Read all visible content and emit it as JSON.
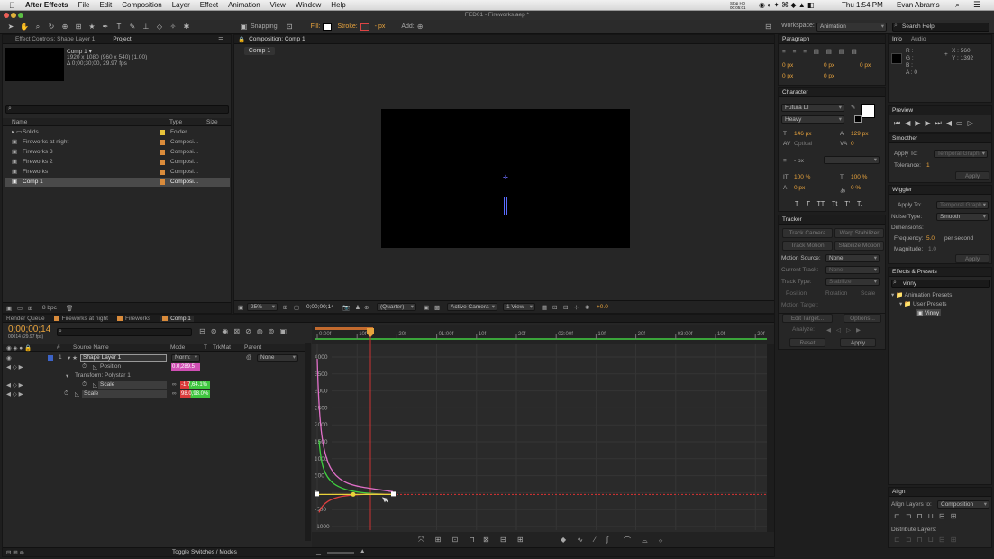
{
  "menubar": {
    "apple": "",
    "items": [
      "After Effects",
      "File",
      "Edit",
      "Composition",
      "Layer",
      "Effect",
      "Animation",
      "View",
      "Window",
      "Help"
    ],
    "status_small": "Stop HD 00:05:01",
    "time": "Thu 1:54 PM",
    "user": "Evan Abrams"
  },
  "window": {
    "title": "FED01 - Fireworks.aep *"
  },
  "toolbar": {
    "snapping": "Snapping",
    "fill": "Fill:",
    "stroke": "Stroke:",
    "px": "- px",
    "add": "Add:",
    "workspace_label": "Workspace:",
    "workspace_value": "Animation",
    "search_placeholder": "Search Help"
  },
  "project": {
    "tab_effect": "Effect Controls: Shape Layer 1",
    "tab_project": "Project",
    "comp_name": "Comp 1 ▾",
    "comp_info1": "1920 x 1080 (960 x 540) (1.00)",
    "comp_info2": "Δ 0;00;30;00, 29.97 fps",
    "search_placeholder": "",
    "col_name": "Name",
    "col_type": "Type",
    "col_size": "Size",
    "items": [
      {
        "name": "Solids",
        "type": "Folder",
        "color": "#e6c23a"
      },
      {
        "name": "Fireworks at night",
        "type": "Composi...",
        "color": "#d98b3b"
      },
      {
        "name": "Fireworks 3",
        "type": "Composi...",
        "color": "#d98b3b"
      },
      {
        "name": "Fireworks 2",
        "type": "Composi...",
        "color": "#d98b3b"
      },
      {
        "name": "Fireworks",
        "type": "Composi...",
        "color": "#d98b3b"
      },
      {
        "name": "Comp 1",
        "type": "Composi...",
        "color": "#d98b3b"
      }
    ],
    "bpc": "8 bpc"
  },
  "composition": {
    "tab": "Composition: Comp 1",
    "subtab": "Comp 1",
    "zoom": "25%",
    "timecode": "0;00;00;14",
    "quality": "(Quarter)",
    "camera": "Active Camera",
    "view": "1 View",
    "exposure": "+0.0"
  },
  "paragraph": {
    "title": "Paragraph",
    "v1": "0 px",
    "v2": "0 px",
    "v3": "0 px",
    "v4": "0 px",
    "v5": "0 px"
  },
  "character": {
    "title": "Character",
    "font": "Futura LT",
    "style": "Heavy",
    "size": "146 px",
    "leading": "129 px",
    "kerning": "Optical",
    "tracking": "0",
    "stroke_px": "- px",
    "vscale": "100 %",
    "hscale": "100 %",
    "baseline": "0 px",
    "tsume": "0 %",
    "styles": [
      "T",
      "T",
      "TT",
      "Tt",
      "T'",
      "T,"
    ]
  },
  "tracker": {
    "title": "Tracker",
    "track_camera": "Track Camera",
    "warp_stabilizer": "Warp Stabilizer",
    "track_motion": "Track Motion",
    "stabilize_motion": "Stabilize Motion",
    "motion_source_label": "Motion Source:",
    "motion_source": "None",
    "current_track_label": "Current Track:",
    "current_track": "None",
    "track_type_label": "Track Type:",
    "track_type": "Stabilize",
    "position": "Position",
    "rotation": "Rotation",
    "scale": "Scale",
    "motion_target": "Motion Target:",
    "edit_target": "Edit Target...",
    "options": "Options...",
    "analyze": "Analyze:",
    "reset": "Reset",
    "apply": "Apply"
  },
  "info": {
    "tab_info": "Info",
    "tab_audio": "Audio",
    "r": "R :",
    "g": "G :",
    "b": "B :",
    "a": "A : 0",
    "x": "X : 560",
    "y": "Y : 1392"
  },
  "preview": {
    "title": "Preview"
  },
  "smoother": {
    "title": "Smoother",
    "apply_to_label": "Apply To:",
    "apply_to": "Temporal Graph",
    "tolerance_label": "Tolerance:",
    "tolerance": "1",
    "apply": "Apply"
  },
  "wiggler": {
    "title": "Wiggler",
    "apply_to_label": "Apply To:",
    "apply_to": "Temporal Graph",
    "noise_label": "Noise Type:",
    "noise": "Smooth",
    "dimensions_label": "Dimensions:",
    "frequency_label": "Frequency:",
    "frequency": "5.0",
    "per_second": "per second",
    "magnitude_label": "Magnitude:",
    "magnitude": "1.0",
    "apply": "Apply"
  },
  "effects": {
    "title": "Effects & Presets",
    "search": "vinny",
    "animation_presets": "Animation Presets",
    "user_presets": "User Presets",
    "vinny": "Vinny"
  },
  "align": {
    "title": "Align",
    "align_layers_to": "Align Layers to:",
    "align_target": "Composition",
    "distribute_layers": "Distribute Layers:"
  },
  "timeline": {
    "tabs": [
      "Render Queue",
      "Fireworks at night",
      "Fireworks",
      "Comp 1"
    ],
    "timecode": "0;00;00;14",
    "frame_info": "00014 (29.97 fps)",
    "col_hash": "#",
    "col_source": "Source Name",
    "col_mode": "Mode",
    "col_t": "T",
    "col_trkmat": "TrkMat",
    "col_parent": "Parent",
    "layer_num": "1",
    "layer_name": "Shape Layer 1",
    "layer_mode": "Norm:",
    "parent_value": "None",
    "prop_position": "Position",
    "position_value": "0.0,289.5",
    "transform_group": "Transform: Polystar 1",
    "prop_scale_inner": "Scale",
    "scale_inner_value": "-1.7,64.1%",
    "prop_scale": "Scale",
    "scale_value": "98.0,98.0%",
    "toggle": "Toggle Switches / Modes",
    "ruler": [
      "0:00f",
      "10f",
      "20f",
      "01:00f",
      "10f",
      "20f",
      "02:00f",
      "10f",
      "20f",
      "03:00f",
      "10f",
      "20f"
    ],
    "y_ticks": [
      "4000",
      "3500",
      "3000",
      "2500",
      "2000",
      "1500",
      "1000",
      "500",
      "0",
      "-500",
      "-1000"
    ]
  }
}
